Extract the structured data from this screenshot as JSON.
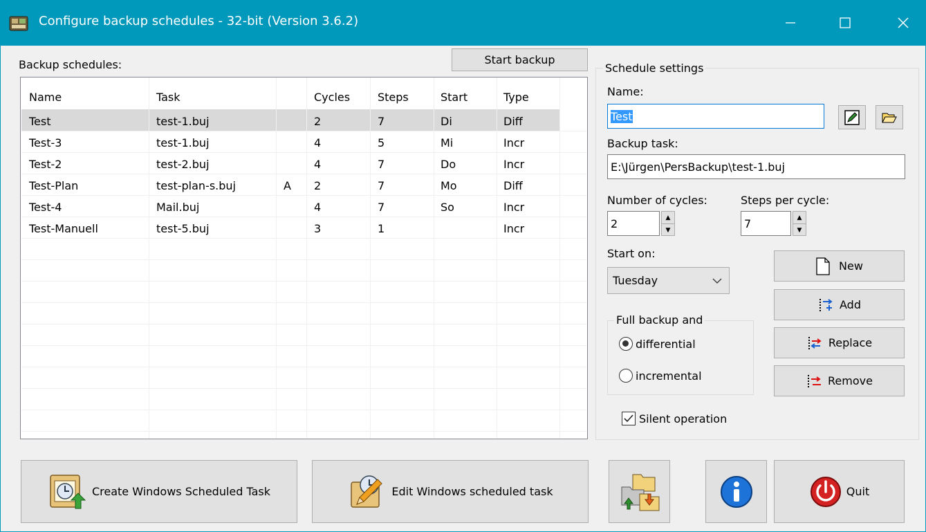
{
  "window": {
    "title": "Configure backup schedules - 32-bit (Version 3.6.2)",
    "minimize": "—",
    "maximize": "☐",
    "close": "✕"
  },
  "schedules": {
    "label": "Backup schedules:",
    "start_backup": "Start backup",
    "columns": [
      "Name",
      "Task",
      "",
      "Cycles",
      "Steps",
      "Start",
      "Type"
    ],
    "rows": [
      [
        "Test",
        "test-1.buj",
        "",
        "2",
        "7",
        "Di",
        "Diff"
      ],
      [
        "Test-3",
        "test-1.buj",
        "",
        "4",
        "5",
        "Mi",
        "Incr"
      ],
      [
        "Test-2",
        "test-2.buj",
        "",
        "4",
        "7",
        "Do",
        "Incr"
      ],
      [
        "Test-Plan",
        "test-plan-s.buj",
        "A",
        "2",
        "7",
        "Mo",
        "Diff"
      ],
      [
        "Test-4",
        "Mail.buj",
        "",
        "4",
        "7",
        "So",
        "Incr"
      ],
      [
        "Test-Manuell",
        "test-5.buj",
        "",
        "3",
        "1",
        "",
        "Incr"
      ]
    ],
    "selected_row": 0
  },
  "settings": {
    "group_title": "Schedule settings",
    "name_label": "Name:",
    "name_value": "Test",
    "task_label": "Backup task:",
    "task_value": "E:\\Jürgen\\PersBackup\\test-1.buj",
    "cycles_label": "Number of cycles:",
    "cycles_value": "2",
    "steps_label": "Steps per cycle:",
    "steps_value": "7",
    "start_label": "Start on:",
    "start_value": "Tuesday",
    "full_group_title": "Full backup and",
    "differential_label": "differential",
    "incremental_label": "incremental",
    "differential_selected": true,
    "silent_label": "Silent operation",
    "silent_checked": true
  },
  "actions": {
    "new": "New",
    "add": "Add",
    "replace": "Replace",
    "remove": "Remove"
  },
  "bottom": {
    "create_task": "Create Windows Scheduled Task",
    "edit_task": "Edit Windows scheduled task",
    "quit": "Quit"
  },
  "colors": {
    "titlebar": "#0099bc",
    "selection": "#3399ff",
    "row_selected": "#d9d9d9"
  }
}
